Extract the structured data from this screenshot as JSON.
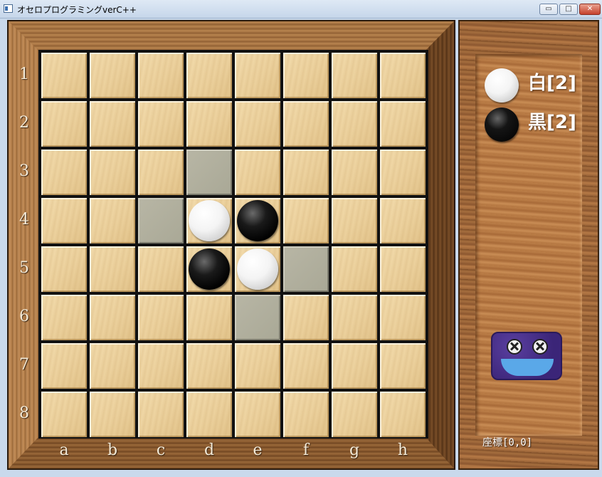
{
  "window": {
    "title": "オセロプログラミングverC++",
    "controls": {
      "minimize": "▭",
      "maximize": "□",
      "close": "✕"
    }
  },
  "board": {
    "files": [
      "a",
      "b",
      "c",
      "d",
      "e",
      "f",
      "g",
      "h"
    ],
    "ranks": [
      "1",
      "2",
      "3",
      "4",
      "5",
      "6",
      "7",
      "8"
    ],
    "discs": [
      {
        "square": "d4",
        "color": "white"
      },
      {
        "square": "e4",
        "color": "black"
      },
      {
        "square": "d5",
        "color": "black"
      },
      {
        "square": "e5",
        "color": "white"
      }
    ],
    "legal_move_highlights": [
      "d3",
      "c4",
      "f5",
      "e6"
    ],
    "colors": {
      "hint": "#a9a896",
      "cell": "#ecd19d",
      "grid_line": "#111111"
    }
  },
  "score": {
    "white_label": "白[2]",
    "black_label": "黒[2]"
  },
  "status": {
    "coordinate": "座標[0,0]"
  },
  "mascot": {
    "icon": "robot-face-icon",
    "color": "#3b2578",
    "mouth_color": "#5aa8e8"
  }
}
